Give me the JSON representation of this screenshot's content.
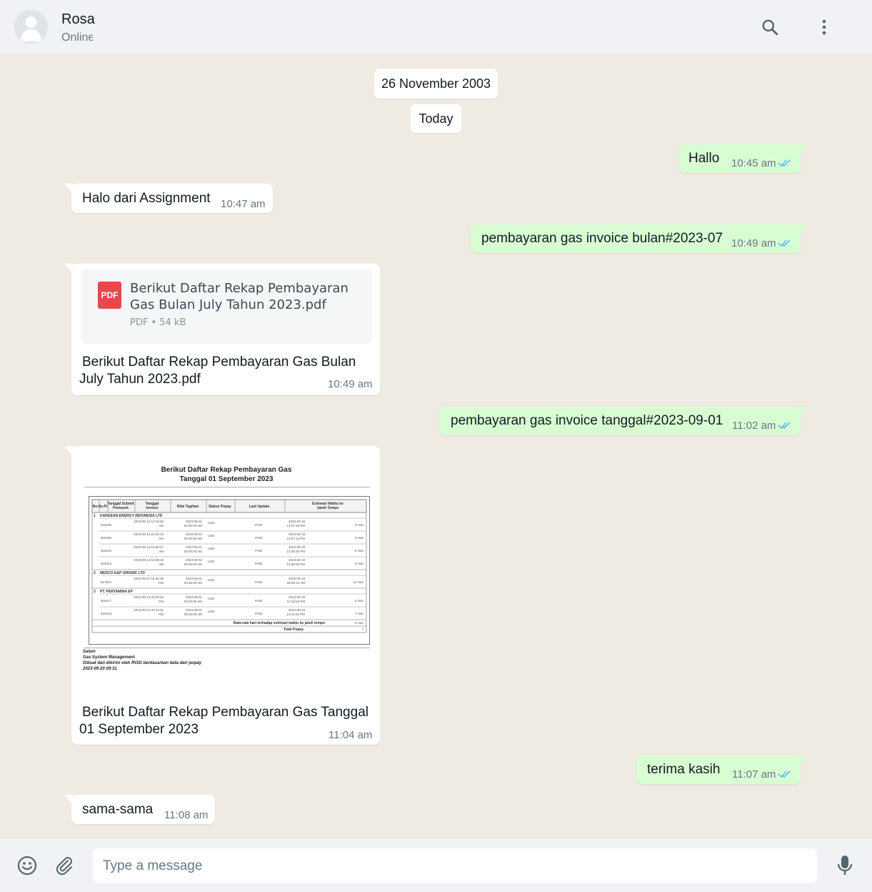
{
  "header": {
    "contact_name": "Rosa",
    "status": "Online"
  },
  "dates": {
    "first": "26 November 2003",
    "second": "Today"
  },
  "messages": [
    {
      "text": "Hallo",
      "time": "10:45 am"
    },
    {
      "text": "Halo dari Assignment",
      "time": "10:47 am"
    },
    {
      "text": "pembayaran gas invoice bulan#2023-07",
      "time": "10:49 am"
    },
    {
      "doc_title": "Berikut Daftar Rekap Pembayaran Gas Bulan July Tahun 2023.pdf",
      "doc_meta": "PDF • 54 kB",
      "doc_icon": "PDF",
      "caption_l1": "Berikut Daftar Rekap Pembayaran Gas Bulan",
      "caption_l2": "July Tahun 2023.pdf",
      "time": "10:49 am"
    },
    {
      "text": "pembayaran gas invoice tanggal#2023-09-01",
      "time": "11:02 am"
    },
    {
      "caption_l1": "Berikut Daftar Rekap Pembayaran Gas Tanggal",
      "caption_l2": "01 September 2023",
      "time": "11:04 am"
    },
    {
      "text": "terima kasih",
      "time": "11:07 am"
    },
    {
      "text": "sama-sama",
      "time": "11:08 am"
    }
  ],
  "preview": {
    "title_l1": "Berikut Daftar Rekap Pembayaran Gas",
    "title_l2": "Tanggal 01 September 2023",
    "columns": [
      "No",
      "No.Pr",
      "Tanggal Submit Pemasok",
      "Tanggal Invoice",
      "Nilai Tagihan",
      "Status Popay",
      "Last Update",
      "Estimasi Waktu ke Jatuh Tempo"
    ],
    "groups": [
      {
        "no": "1",
        "name": "KANGEAN ENERGY INDONESIA LTD",
        "rows": [
          {
            "pr": "818200",
            "submit": "2023-09-13 10:16:58 AM",
            "invoice": "2023-09-01 00:00:00 AM",
            "value": "USD",
            "status": "PAID",
            "update": "2023-09-19 14:07:19 PM",
            "est": "8 Hari"
          },
          {
            "pr": "818208",
            "submit": "2023-09-13 10:24:15 AM",
            "invoice": "2023-09-01 00:00:00 AM",
            "value": "USD",
            "status": "PAID",
            "update": "2023-09-19 14:07:12 PM",
            "est": "8 Hari"
          },
          {
            "pr": "818210",
            "submit": "2023-09-13 10:30:27 AM",
            "invoice": "2023-09-01 00:00:00 AM",
            "value": "USD",
            "status": "PAID",
            "update": "2023-09-19 14:08:29 PM",
            "est": "8 Hari"
          },
          {
            "pr": "818213",
            "submit": "2023-09-13 10:38:19 AM",
            "invoice": "2023-09-01 00:00:00 AM",
            "value": "USD",
            "status": "PAID",
            "update": "2023-09-19 14:08:50 PM",
            "est": "8 Hari"
          }
        ]
      },
      {
        "no": "2",
        "name": "MEDCO E&P GRISSIK LTD",
        "rows": [
          {
            "pr": "817824",
            "submit": "2023-09-07 16:45:38 PM",
            "invoice": "2023-09-01 00:00:00 AM",
            "value": "USD",
            "status": "PAID",
            "update": "2023-09-19 09:06:31 AM",
            "est": "14 Hari"
          }
        ]
      },
      {
        "no": "3",
        "name": "PT. PERTAMINA EP",
        "rows": [
          {
            "pr": "818417",
            "submit": "2023-09-14 20:29:36 PM",
            "invoice": "2023-09-01 00:00:00 AM",
            "value": "USD",
            "status": "PAID",
            "update": "2023-09-19 13:16:53 PM",
            "est": "6 Hari"
          },
          {
            "pr": "818418",
            "submit": "2023-09-14 20:44:31 PM",
            "invoice": "2023-09-01 00:00:00 AM",
            "value": "USD",
            "status": "PAID",
            "update": "2023-09-19 13:15:48 PM",
            "est": "7 Hari"
          }
        ]
      }
    ],
    "avg_label": "Rata-rata hari terhadap estimasi waktu ke jatuh tempo",
    "avg_value": "8 Hari",
    "total_label": "Total Popay",
    "total_value": "7",
    "footer": [
      "Salam",
      "Gas System Management",
      "Dibuat dan dikirim oleh ROSI berdasarkan data dari popay",
      "2023-09-20 09:31"
    ]
  },
  "composer": {
    "placeholder": "Type a message"
  },
  "icons": {
    "search": "search-icon",
    "menu": "more-vert-icon",
    "emoji": "emoji-icon",
    "attach": "paperclip-icon",
    "mic": "microphone-icon",
    "ticks": "double-check-icon"
  },
  "colors": {
    "outgoing_bubble": "#d9fdd3",
    "incoming_bubble": "#ffffff",
    "read_ticks": "#53bdeb",
    "background": "#efeae2"
  }
}
